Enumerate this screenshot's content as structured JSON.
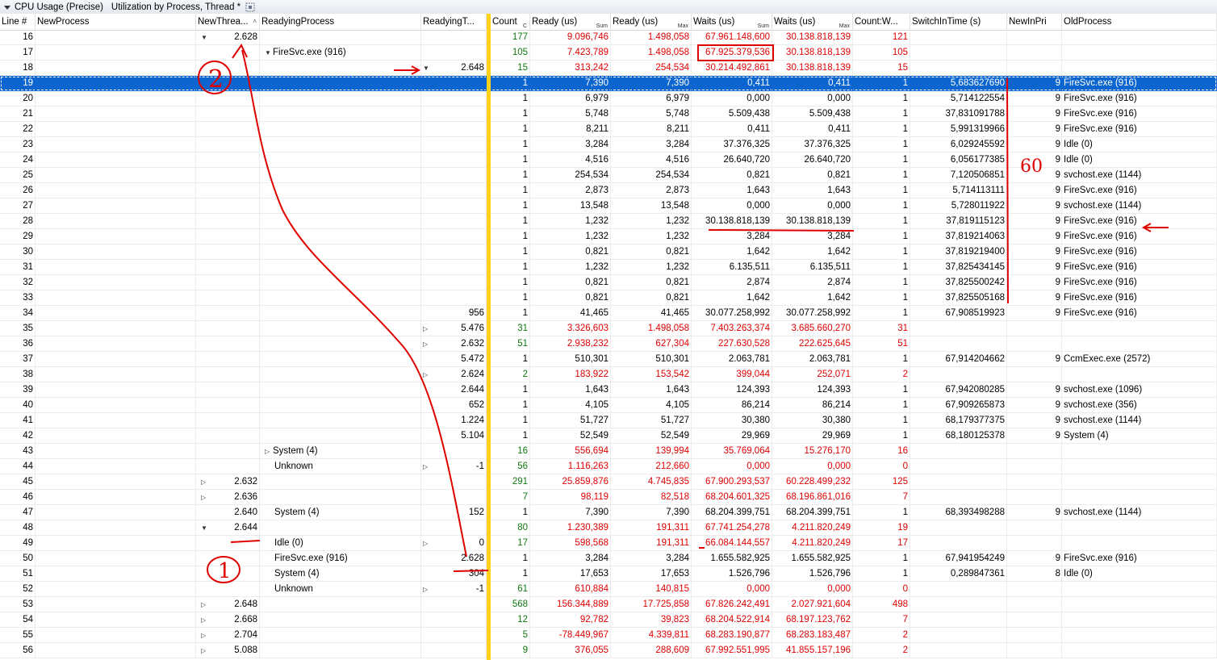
{
  "window": {
    "tab1": "CPU Usage (Precise)",
    "tab2": "Utilization by Process, Thread *"
  },
  "columns": [
    {
      "label": "Line #",
      "agg": ""
    },
    {
      "label": "NewProcess",
      "agg": ""
    },
    {
      "label": "NewThrea...",
      "agg": ""
    },
    {
      "label": "ReadyingProcess",
      "agg": ""
    },
    {
      "label": "ReadyingT...",
      "agg": ""
    },
    {
      "label": "Count",
      "agg": "C"
    },
    {
      "label": "Ready (us)",
      "agg": "Sum"
    },
    {
      "label": "Ready (us)",
      "agg": "Max"
    },
    {
      "label": "Waits (us)",
      "agg": "Sum"
    },
    {
      "label": "Waits (us)",
      "agg": "Max"
    },
    {
      "label": "Count:W...",
      "agg": ""
    },
    {
      "label": "SwitchInTime (s)",
      "agg": ""
    },
    {
      "label": "NewInPri",
      "agg": ""
    },
    {
      "label": "OldProcess",
      "agg": ""
    }
  ],
  "rows": [
    {
      "line": "16",
      "newproc": "",
      "nt_exp": "▼",
      "newthread": "2.628",
      "rp_exp": "",
      "rproc": "",
      "rt_exp": "",
      "rthread": "",
      "count": "177",
      "ready_sum": "9.096,746",
      "ready_max": "1.498,058",
      "waits_sum": "67.961.148,600",
      "waits_max": "30.138.818,139",
      "countw": "121",
      "switch": "",
      "pri": "",
      "oldproc": "",
      "agg": true
    },
    {
      "line": "17",
      "newproc": "",
      "nt_exp": "",
      "newthread": "",
      "rp_exp": "▼",
      "rproc": "FireSvc.exe (916)",
      "rt_exp": "",
      "rthread": "",
      "count": "105",
      "ready_sum": "7.423,789",
      "ready_max": "1.498,058",
      "waits_sum": "67.925.379,536",
      "waits_max": "30.138.818,139",
      "countw": "105",
      "switch": "",
      "pri": "",
      "oldproc": "",
      "agg": true
    },
    {
      "line": "18",
      "newproc": "",
      "nt_exp": "",
      "newthread": "",
      "rp_exp": "",
      "rproc": "",
      "rt_exp": "▼",
      "rthread": "2.648",
      "count": "15",
      "ready_sum": "313,242",
      "ready_max": "254,534",
      "waits_sum": "30.214.492,861",
      "waits_max": "30.138.818,139",
      "countw": "15",
      "switch": "",
      "pri": "",
      "oldproc": "",
      "agg": true
    },
    {
      "line": "19",
      "newproc": "",
      "nt_exp": "",
      "newthread": "",
      "rp_exp": "",
      "rproc": "",
      "rt_exp": "",
      "rthread": "",
      "count": "1",
      "ready_sum": "7,390",
      "ready_max": "7,390",
      "waits_sum": "0,411",
      "waits_max": "0,411",
      "countw": "1",
      "switch": "5,683627690",
      "pri": "9",
      "oldproc": "FireSvc.exe (916)",
      "agg": false,
      "selected": true
    },
    {
      "line": "20",
      "newproc": "",
      "nt_exp": "",
      "newthread": "",
      "rp_exp": "",
      "rproc": "",
      "rt_exp": "",
      "rthread": "",
      "count": "1",
      "ready_sum": "6,979",
      "ready_max": "6,979",
      "waits_sum": "0,000",
      "waits_max": "0,000",
      "countw": "1",
      "switch": "5,714122554",
      "pri": "9",
      "oldproc": "FireSvc.exe (916)",
      "agg": false
    },
    {
      "line": "21",
      "newproc": "",
      "nt_exp": "",
      "newthread": "",
      "rp_exp": "",
      "rproc": "",
      "rt_exp": "",
      "rthread": "",
      "count": "1",
      "ready_sum": "5,748",
      "ready_max": "5,748",
      "waits_sum": "5.509,438",
      "waits_max": "5.509,438",
      "countw": "1",
      "switch": "37,831091788",
      "pri": "9",
      "oldproc": "FireSvc.exe (916)",
      "agg": false
    },
    {
      "line": "22",
      "newproc": "",
      "nt_exp": "",
      "newthread": "",
      "rp_exp": "",
      "rproc": "",
      "rt_exp": "",
      "rthread": "",
      "count": "1",
      "ready_sum": "8,211",
      "ready_max": "8,211",
      "waits_sum": "0,411",
      "waits_max": "0,411",
      "countw": "1",
      "switch": "5,991319966",
      "pri": "9",
      "oldproc": "FireSvc.exe (916)",
      "agg": false
    },
    {
      "line": "23",
      "newproc": "",
      "nt_exp": "",
      "newthread": "",
      "rp_exp": "",
      "rproc": "",
      "rt_exp": "",
      "rthread": "",
      "count": "1",
      "ready_sum": "3,284",
      "ready_max": "3,284",
      "waits_sum": "37.376,325",
      "waits_max": "37.376,325",
      "countw": "1",
      "switch": "6,029245592",
      "pri": "9",
      "oldproc": "Idle (0)",
      "agg": false
    },
    {
      "line": "24",
      "newproc": "",
      "nt_exp": "",
      "newthread": "",
      "rp_exp": "",
      "rproc": "",
      "rt_exp": "",
      "rthread": "",
      "count": "1",
      "ready_sum": "4,516",
      "ready_max": "4,516",
      "waits_sum": "26.640,720",
      "waits_max": "26.640,720",
      "countw": "1",
      "switch": "6,056177385",
      "pri": "9",
      "oldproc": "Idle (0)",
      "agg": false
    },
    {
      "line": "25",
      "newproc": "",
      "nt_exp": "",
      "newthread": "",
      "rp_exp": "",
      "rproc": "",
      "rt_exp": "",
      "rthread": "",
      "count": "1",
      "ready_sum": "254,534",
      "ready_max": "254,534",
      "waits_sum": "0,821",
      "waits_max": "0,821",
      "countw": "1",
      "switch": "7,120506851",
      "pri": "9",
      "oldproc": "svchost.exe (1144)",
      "agg": false
    },
    {
      "line": "26",
      "newproc": "",
      "nt_exp": "",
      "newthread": "",
      "rp_exp": "",
      "rproc": "",
      "rt_exp": "",
      "rthread": "",
      "count": "1",
      "ready_sum": "2,873",
      "ready_max": "2,873",
      "waits_sum": "1,643",
      "waits_max": "1,643",
      "countw": "1",
      "switch": "5,714113111",
      "pri": "9",
      "oldproc": "FireSvc.exe (916)",
      "agg": false
    },
    {
      "line": "27",
      "newproc": "",
      "nt_exp": "",
      "newthread": "",
      "rp_exp": "",
      "rproc": "",
      "rt_exp": "",
      "rthread": "",
      "count": "1",
      "ready_sum": "13,548",
      "ready_max": "13,548",
      "waits_sum": "0,000",
      "waits_max": "0,000",
      "countw": "1",
      "switch": "5,728011922",
      "pri": "9",
      "oldproc": "svchost.exe (1144)",
      "agg": false
    },
    {
      "line": "28",
      "newproc": "",
      "nt_exp": "",
      "newthread": "",
      "rp_exp": "",
      "rproc": "",
      "rt_exp": "",
      "rthread": "",
      "count": "1",
      "ready_sum": "1,232",
      "ready_max": "1,232",
      "waits_sum": "30.138.818,139",
      "waits_max": "30.138.818,139",
      "countw": "1",
      "switch": "37,819115123",
      "pri": "9",
      "oldproc": "FireSvc.exe (916)",
      "agg": false
    },
    {
      "line": "29",
      "newproc": "",
      "nt_exp": "",
      "newthread": "",
      "rp_exp": "",
      "rproc": "",
      "rt_exp": "",
      "rthread": "",
      "count": "1",
      "ready_sum": "1,232",
      "ready_max": "1,232",
      "waits_sum": "3,284",
      "waits_max": "3,284",
      "countw": "1",
      "switch": "37,819214063",
      "pri": "9",
      "oldproc": "FireSvc.exe (916)",
      "agg": false
    },
    {
      "line": "30",
      "newproc": "",
      "nt_exp": "",
      "newthread": "",
      "rp_exp": "",
      "rproc": "",
      "rt_exp": "",
      "rthread": "",
      "count": "1",
      "ready_sum": "0,821",
      "ready_max": "0,821",
      "waits_sum": "1,642",
      "waits_max": "1,642",
      "countw": "1",
      "switch": "37,819219400",
      "pri": "9",
      "oldproc": "FireSvc.exe (916)",
      "agg": false
    },
    {
      "line": "31",
      "newproc": "",
      "nt_exp": "",
      "newthread": "",
      "rp_exp": "",
      "rproc": "",
      "rt_exp": "",
      "rthread": "",
      "count": "1",
      "ready_sum": "1,232",
      "ready_max": "1,232",
      "waits_sum": "6.135,511",
      "waits_max": "6.135,511",
      "countw": "1",
      "switch": "37,825434145",
      "pri": "9",
      "oldproc": "FireSvc.exe (916)",
      "agg": false
    },
    {
      "line": "32",
      "newproc": "",
      "nt_exp": "",
      "newthread": "",
      "rp_exp": "",
      "rproc": "",
      "rt_exp": "",
      "rthread": "",
      "count": "1",
      "ready_sum": "0,821",
      "ready_max": "0,821",
      "waits_sum": "2,874",
      "waits_max": "2,874",
      "countw": "1",
      "switch": "37,825500242",
      "pri": "9",
      "oldproc": "FireSvc.exe (916)",
      "agg": false
    },
    {
      "line": "33",
      "newproc": "",
      "nt_exp": "",
      "newthread": "",
      "rp_exp": "",
      "rproc": "",
      "rt_exp": "",
      "rthread": "",
      "count": "1",
      "ready_sum": "0,821",
      "ready_max": "0,821",
      "waits_sum": "1,642",
      "waits_max": "1,642",
      "countw": "1",
      "switch": "37,825505168",
      "pri": "9",
      "oldproc": "FireSvc.exe (916)",
      "agg": false
    },
    {
      "line": "34",
      "newproc": "",
      "nt_exp": "",
      "newthread": "",
      "rp_exp": "",
      "rproc": "",
      "rt_exp": "",
      "rthread": "956",
      "count": "1",
      "ready_sum": "41,465",
      "ready_max": "41,465",
      "waits_sum": "30.077.258,992",
      "waits_max": "30.077.258,992",
      "countw": "1",
      "switch": "67,908519923",
      "pri": "9",
      "oldproc": "FireSvc.exe (916)",
      "agg": false
    },
    {
      "line": "35",
      "newproc": "",
      "nt_exp": "",
      "newthread": "",
      "rp_exp": "",
      "rproc": "",
      "rt_exp": "▷",
      "rthread": "5.476",
      "count": "31",
      "ready_sum": "3.326,603",
      "ready_max": "1.498,058",
      "waits_sum": "7.403.263,374",
      "waits_max": "3.685.660,270",
      "countw": "31",
      "switch": "",
      "pri": "",
      "oldproc": "",
      "agg": true
    },
    {
      "line": "36",
      "newproc": "",
      "nt_exp": "",
      "newthread": "",
      "rp_exp": "",
      "rproc": "",
      "rt_exp": "▷",
      "rthread": "2.632",
      "count": "51",
      "ready_sum": "2.938,232",
      "ready_max": "627,304",
      "waits_sum": "227.630,528",
      "waits_max": "222.625,645",
      "countw": "51",
      "switch": "",
      "pri": "",
      "oldproc": "",
      "agg": true
    },
    {
      "line": "37",
      "newproc": "",
      "nt_exp": "",
      "newthread": "",
      "rp_exp": "",
      "rproc": "",
      "rt_exp": "",
      "rthread": "5.472",
      "count": "1",
      "ready_sum": "510,301",
      "ready_max": "510,301",
      "waits_sum": "2.063,781",
      "waits_max": "2.063,781",
      "countw": "1",
      "switch": "67,914204662",
      "pri": "9",
      "oldproc": "CcmExec.exe (2572)",
      "agg": false
    },
    {
      "line": "38",
      "newproc": "",
      "nt_exp": "",
      "newthread": "",
      "rp_exp": "",
      "rproc": "",
      "rt_exp": "▷",
      "rthread": "2.624",
      "count": "2",
      "ready_sum": "183,922",
      "ready_max": "153,542",
      "waits_sum": "399,044",
      "waits_max": "252,071",
      "countw": "2",
      "switch": "",
      "pri": "",
      "oldproc": "",
      "agg": true
    },
    {
      "line": "39",
      "newproc": "",
      "nt_exp": "",
      "newthread": "",
      "rp_exp": "",
      "rproc": "",
      "rt_exp": "",
      "rthread": "2.644",
      "count": "1",
      "ready_sum": "1,643",
      "ready_max": "1,643",
      "waits_sum": "124,393",
      "waits_max": "124,393",
      "countw": "1",
      "switch": "67,942080285",
      "pri": "9",
      "oldproc": "svchost.exe (1096)",
      "agg": false
    },
    {
      "line": "40",
      "newproc": "",
      "nt_exp": "",
      "newthread": "",
      "rp_exp": "",
      "rproc": "",
      "rt_exp": "",
      "rthread": "652",
      "count": "1",
      "ready_sum": "4,105",
      "ready_max": "4,105",
      "waits_sum": "86,214",
      "waits_max": "86,214",
      "countw": "1",
      "switch": "67,909265873",
      "pri": "9",
      "oldproc": "svchost.exe (356)",
      "agg": false
    },
    {
      "line": "41",
      "newproc": "",
      "nt_exp": "",
      "newthread": "",
      "rp_exp": "",
      "rproc": "",
      "rt_exp": "",
      "rthread": "1.224",
      "count": "1",
      "ready_sum": "51,727",
      "ready_max": "51,727",
      "waits_sum": "30,380",
      "waits_max": "30,380",
      "countw": "1",
      "switch": "68,179377375",
      "pri": "9",
      "oldproc": "svchost.exe (1144)",
      "agg": false
    },
    {
      "line": "42",
      "newproc": "",
      "nt_exp": "",
      "newthread": "",
      "rp_exp": "",
      "rproc": "",
      "rt_exp": "",
      "rthread": "5.104",
      "count": "1",
      "ready_sum": "52,549",
      "ready_max": "52,549",
      "waits_sum": "29,969",
      "waits_max": "29,969",
      "countw": "1",
      "switch": "68,180125378",
      "pri": "9",
      "oldproc": "System (4)",
      "agg": false
    },
    {
      "line": "43",
      "newproc": "",
      "nt_exp": "",
      "newthread": "",
      "rp_exp": "▷",
      "rproc": "System (4)",
      "rt_exp": "",
      "rthread": "",
      "count": "16",
      "ready_sum": "556,694",
      "ready_max": "139,994",
      "waits_sum": "35.769,064",
      "waits_max": "15.276,170",
      "countw": "16",
      "switch": "",
      "pri": "",
      "oldproc": "",
      "agg": true
    },
    {
      "line": "44",
      "newproc": "",
      "nt_exp": "",
      "newthread": "",
      "rp_exp": "",
      "rproc": "Unknown",
      "rt_exp": "▷",
      "rthread": "-1",
      "count": "56",
      "ready_sum": "1.116,263",
      "ready_max": "212,660",
      "waits_sum": "0,000",
      "waits_max": "0,000",
      "countw": "0",
      "switch": "",
      "pri": "",
      "oldproc": "",
      "agg": true
    },
    {
      "line": "45",
      "newproc": "",
      "nt_exp": "▷",
      "newthread": "2.632",
      "rp_exp": "",
      "rproc": "",
      "rt_exp": "",
      "rthread": "",
      "count": "291",
      "ready_sum": "25.859,876",
      "ready_max": "4.745,835",
      "waits_sum": "67.900.293,537",
      "waits_max": "60.228.499,232",
      "countw": "125",
      "switch": "",
      "pri": "",
      "oldproc": "",
      "agg": true
    },
    {
      "line": "46",
      "newproc": "",
      "nt_exp": "▷",
      "newthread": "2.636",
      "rp_exp": "",
      "rproc": "",
      "rt_exp": "",
      "rthread": "",
      "count": "7",
      "ready_sum": "98,119",
      "ready_max": "82,518",
      "waits_sum": "68.204.601,325",
      "waits_max": "68.196.861,016",
      "countw": "7",
      "switch": "",
      "pri": "",
      "oldproc": "",
      "agg": true
    },
    {
      "line": "47",
      "newproc": "",
      "nt_exp": "",
      "newthread": "2.640",
      "rp_exp": "",
      "rproc": "System (4)",
      "rt_exp": "",
      "rthread": "152",
      "count": "1",
      "ready_sum": "7,390",
      "ready_max": "7,390",
      "waits_sum": "68.204.399,751",
      "waits_max": "68.204.399,751",
      "countw": "1",
      "switch": "68,393498288",
      "pri": "9",
      "oldproc": "svchost.exe (1144)",
      "agg": false
    },
    {
      "line": "48",
      "newproc": "",
      "nt_exp": "▼",
      "newthread": "2.644",
      "rp_exp": "",
      "rproc": "",
      "rt_exp": "",
      "rthread": "",
      "count": "80",
      "ready_sum": "1.230,389",
      "ready_max": "191,311",
      "waits_sum": "67.741.254,278",
      "waits_max": "4.211.820,249",
      "countw": "19",
      "switch": "",
      "pri": "",
      "oldproc": "",
      "agg": true
    },
    {
      "line": "49",
      "newproc": "",
      "nt_exp": "",
      "newthread": "",
      "rp_exp": "",
      "rproc": "Idle (0)",
      "rt_exp": "▷",
      "rthread": "0",
      "count": "17",
      "ready_sum": "598,568",
      "ready_max": "191,311",
      "waits_sum": "66.084.144,557",
      "waits_max": "4.211.820,249",
      "countw": "17",
      "switch": "",
      "pri": "",
      "oldproc": "",
      "agg": true
    },
    {
      "line": "50",
      "newproc": "",
      "nt_exp": "",
      "newthread": "",
      "rp_exp": "",
      "rproc": "FireSvc.exe (916)",
      "rt_exp": "",
      "rthread": "2.628",
      "count": "1",
      "ready_sum": "3,284",
      "ready_max": "3,284",
      "waits_sum": "1.655.582,925",
      "waits_max": "1.655.582,925",
      "countw": "1",
      "switch": "67,941954249",
      "pri": "9",
      "oldproc": "FireSvc.exe (916)",
      "agg": false
    },
    {
      "line": "51",
      "newproc": "",
      "nt_exp": "",
      "newthread": "",
      "rp_exp": "",
      "rproc": "System (4)",
      "rt_exp": "",
      "rthread": "304",
      "count": "1",
      "ready_sum": "17,653",
      "ready_max": "17,653",
      "waits_sum": "1.526,796",
      "waits_max": "1.526,796",
      "countw": "1",
      "switch": "0,289847361",
      "pri": "8",
      "oldproc": "Idle (0)",
      "agg": false
    },
    {
      "line": "52",
      "newproc": "",
      "nt_exp": "",
      "newthread": "",
      "rp_exp": "",
      "rproc": "Unknown",
      "rt_exp": "▷",
      "rthread": "-1",
      "count": "61",
      "ready_sum": "610,884",
      "ready_max": "140,815",
      "waits_sum": "0,000",
      "waits_max": "0,000",
      "countw": "0",
      "switch": "",
      "pri": "",
      "oldproc": "",
      "agg": true
    },
    {
      "line": "53",
      "newproc": "",
      "nt_exp": "▷",
      "newthread": "2.648",
      "rp_exp": "",
      "rproc": "",
      "rt_exp": "",
      "rthread": "",
      "count": "568",
      "ready_sum": "156.344,889",
      "ready_max": "17.725,858",
      "waits_sum": "67.826.242,491",
      "waits_max": "2.027.921,604",
      "countw": "498",
      "switch": "",
      "pri": "",
      "oldproc": "",
      "agg": true
    },
    {
      "line": "54",
      "newproc": "",
      "nt_exp": "▷",
      "newthread": "2.668",
      "rp_exp": "",
      "rproc": "",
      "rt_exp": "",
      "rthread": "",
      "count": "12",
      "ready_sum": "92,782",
      "ready_max": "39,823",
      "waits_sum": "68.204.522,914",
      "waits_max": "68.197.123,762",
      "countw": "7",
      "switch": "",
      "pri": "",
      "oldproc": "",
      "agg": true
    },
    {
      "line": "55",
      "newproc": "",
      "nt_exp": "▷",
      "newthread": "2.704",
      "rp_exp": "",
      "rproc": "",
      "rt_exp": "",
      "rthread": "",
      "count": "5",
      "ready_sum": "-78.449,967",
      "ready_max": "4.339,811",
      "waits_sum": "68.283.190,877",
      "waits_max": "68.283.183,487",
      "countw": "2",
      "switch": "",
      "pri": "",
      "oldproc": "",
      "agg": true
    },
    {
      "line": "56",
      "newproc": "",
      "nt_exp": "▷",
      "newthread": "5.088",
      "rp_exp": "",
      "rproc": "",
      "rt_exp": "",
      "rthread": "",
      "count": "9",
      "ready_sum": "376,055",
      "ready_max": "288,609",
      "waits_sum": "67.992.551,995",
      "waits_max": "41.855.157,196",
      "countw": "2",
      "switch": "",
      "pri": "",
      "oldproc": "",
      "agg": true
    }
  ],
  "annotations": {
    "label_two": "2",
    "label_one": "1",
    "label_sixty": "60"
  },
  "colors": {
    "selection": "#0d66d0",
    "aggregate_value": "#e00000",
    "aggregate_count": "#107810",
    "divider": "#ffd21a",
    "annotation": "#e00000"
  }
}
